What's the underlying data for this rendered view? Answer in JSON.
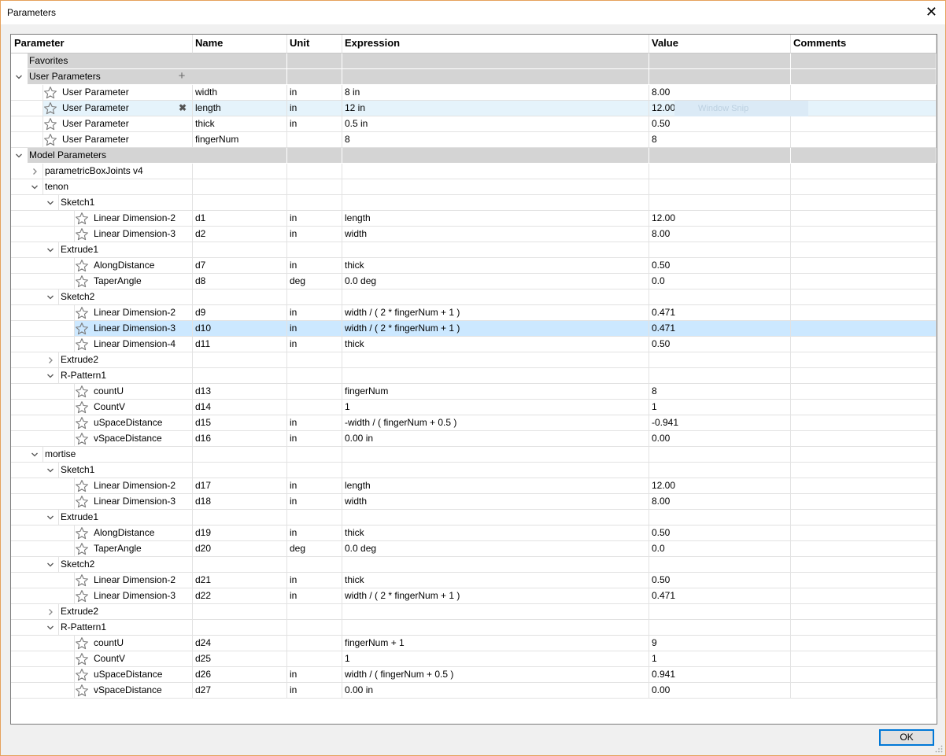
{
  "window": {
    "title": "Parameters",
    "close_glyph": "✕"
  },
  "columns": [
    "Parameter",
    "Name",
    "Unit",
    "Expression",
    "Value",
    "Comments"
  ],
  "sections": {
    "favorites": "Favorites",
    "user": "User Parameters",
    "model": "Model Parameters"
  },
  "user_rows": [
    {
      "label": "User Parameter",
      "name": "width",
      "unit": "in",
      "expr": "8 in",
      "value": "8.00"
    },
    {
      "label": "User Parameter",
      "name": "length",
      "unit": "in",
      "expr": "12 in",
      "value": "12.00"
    },
    {
      "label": "User Parameter",
      "name": "thick",
      "unit": "in",
      "expr": "0.5 in",
      "value": "0.50"
    },
    {
      "label": "User Parameter",
      "name": "fingerNum",
      "unit": "",
      "expr": "8",
      "value": "8"
    }
  ],
  "model_rows": [
    {
      "type": "comp",
      "label": "parametricBoxJoints v4",
      "state": "collapsed"
    },
    {
      "type": "comp",
      "label": "tenon",
      "state": "expanded"
    },
    {
      "type": "feat",
      "label": "Sketch1",
      "state": "expanded"
    },
    {
      "type": "param",
      "label": "Linear Dimension-2",
      "name": "d1",
      "unit": "in",
      "expr": "length",
      "value": "12.00"
    },
    {
      "type": "param",
      "label": "Linear Dimension-3",
      "name": "d2",
      "unit": "in",
      "expr": "width",
      "value": "8.00"
    },
    {
      "type": "feat",
      "label": "Extrude1",
      "state": "expanded"
    },
    {
      "type": "param",
      "label": "AlongDistance",
      "name": "d7",
      "unit": "in",
      "expr": "thick",
      "value": "0.50"
    },
    {
      "type": "param",
      "label": "TaperAngle",
      "name": "d8",
      "unit": "deg",
      "expr": "0.0 deg",
      "value": "0.0"
    },
    {
      "type": "feat",
      "label": "Sketch2",
      "state": "expanded"
    },
    {
      "type": "param",
      "label": "Linear Dimension-2",
      "name": "d9",
      "unit": "in",
      "expr": "width / ( 2 * fingerNum + 1 )",
      "value": "0.471"
    },
    {
      "type": "param",
      "label": "Linear Dimension-3",
      "name": "d10",
      "unit": "in",
      "expr": "width / ( 2 * fingerNum + 1 )",
      "value": "0.471",
      "selected": true
    },
    {
      "type": "param",
      "label": "Linear Dimension-4",
      "name": "d11",
      "unit": "in",
      "expr": "thick",
      "value": "0.50"
    },
    {
      "type": "feat",
      "label": "Extrude2",
      "state": "collapsed"
    },
    {
      "type": "feat",
      "label": "R-Pattern1",
      "state": "expanded"
    },
    {
      "type": "param",
      "label": "countU",
      "name": "d13",
      "unit": "",
      "expr": "fingerNum",
      "value": "8"
    },
    {
      "type": "param",
      "label": "CountV",
      "name": "d14",
      "unit": "",
      "expr": "1",
      "value": "1"
    },
    {
      "type": "param",
      "label": "uSpaceDistance",
      "name": "d15",
      "unit": "in",
      "expr": "-width / ( fingerNum + 0.5 )",
      "value": "-0.941"
    },
    {
      "type": "param",
      "label": "vSpaceDistance",
      "name": "d16",
      "unit": "in",
      "expr": "0.00 in",
      "value": "0.00"
    },
    {
      "type": "comp",
      "label": "mortise",
      "state": "expanded"
    },
    {
      "type": "feat",
      "label": "Sketch1",
      "state": "expanded"
    },
    {
      "type": "param",
      "label": "Linear Dimension-2",
      "name": "d17",
      "unit": "in",
      "expr": "length",
      "value": "12.00"
    },
    {
      "type": "param",
      "label": "Linear Dimension-3",
      "name": "d18",
      "unit": "in",
      "expr": "width",
      "value": "8.00"
    },
    {
      "type": "feat",
      "label": "Extrude1",
      "state": "expanded"
    },
    {
      "type": "param",
      "label": "AlongDistance",
      "name": "d19",
      "unit": "in",
      "expr": "thick",
      "value": "0.50"
    },
    {
      "type": "param",
      "label": "TaperAngle",
      "name": "d20",
      "unit": "deg",
      "expr": "0.0 deg",
      "value": "0.0"
    },
    {
      "type": "feat",
      "label": "Sketch2",
      "state": "expanded"
    },
    {
      "type": "param",
      "label": "Linear Dimension-2",
      "name": "d21",
      "unit": "in",
      "expr": "thick",
      "value": "0.50"
    },
    {
      "type": "param",
      "label": "Linear Dimension-3",
      "name": "d22",
      "unit": "in",
      "expr": "width / ( 2 * fingerNum + 1 )",
      "value": "0.471"
    },
    {
      "type": "feat",
      "label": "Extrude2",
      "state": "collapsed"
    },
    {
      "type": "feat",
      "label": "R-Pattern1",
      "state": "expanded"
    },
    {
      "type": "param",
      "label": "countU",
      "name": "d24",
      "unit": "",
      "expr": "fingerNum + 1",
      "value": "9"
    },
    {
      "type": "param",
      "label": "CountV",
      "name": "d25",
      "unit": "",
      "expr": "1",
      "value": "1"
    },
    {
      "type": "param",
      "label": "uSpaceDistance",
      "name": "d26",
      "unit": "in",
      "expr": "width / ( fingerNum + 0.5 )",
      "value": "0.941"
    },
    {
      "type": "param",
      "label": "vSpaceDistance",
      "name": "d27",
      "unit": "in",
      "expr": "0.00 in",
      "value": "0.00"
    }
  ],
  "overlay": {
    "snip_text": "Window Snip"
  },
  "buttons": {
    "ok": "OK"
  },
  "icons": {
    "favorite": "star-outline-icon",
    "add": "plus-icon",
    "delete": "x-icon",
    "expanded": "chevron-down-icon",
    "collapsed": "chevron-right-icon"
  },
  "colors": {
    "selected_row": "#cce8ff",
    "hover_row": "#e5f3fb",
    "section_bg": "#d4d4d4",
    "ok_border": "#0078d7"
  }
}
